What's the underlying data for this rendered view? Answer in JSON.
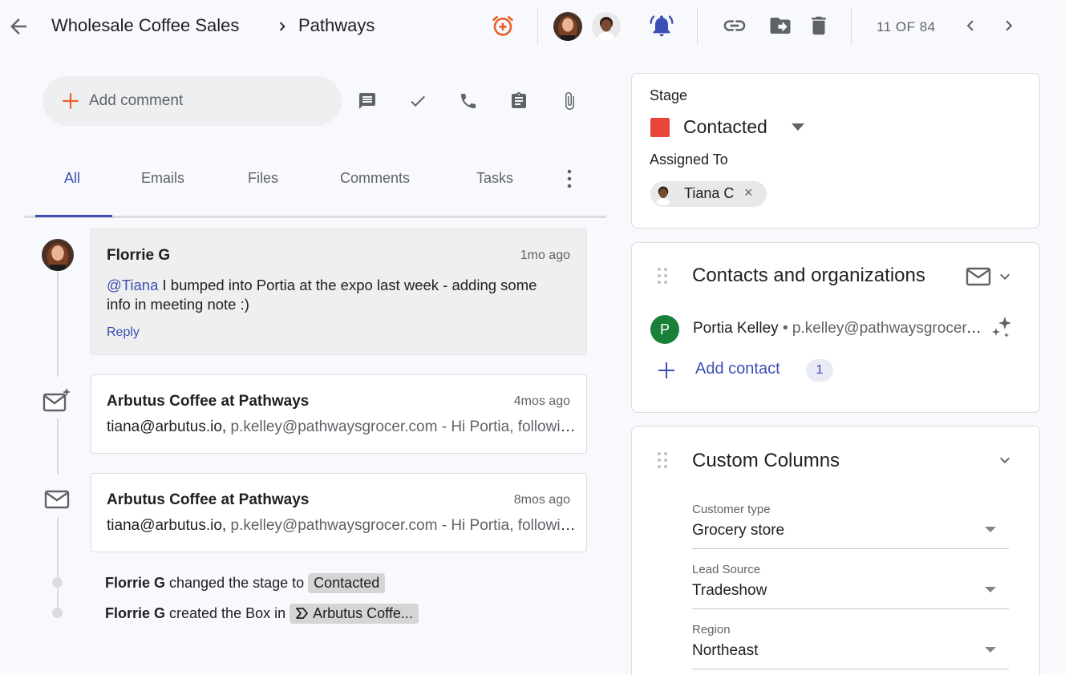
{
  "header": {
    "breadcrumb_parent": "Wholesale Coffee Sales",
    "breadcrumb_current": "Pathways",
    "counter": "11 OF 84",
    "icons": [
      "back-arrow-icon",
      "alarm-add-icon",
      "notification-bell-icon",
      "link-icon",
      "move-folder-icon",
      "trash-icon",
      "chevron-left-icon",
      "chevron-right-icon"
    ],
    "accent_alarm": "#e8612c",
    "accent_bell": "#3c4fb5"
  },
  "composer": {
    "placeholder": "Add comment"
  },
  "tabs": [
    "All",
    "Emails",
    "Files",
    "Comments",
    "Tasks"
  ],
  "timeline": {
    "comment": {
      "author": "Florrie G",
      "time": "1mo ago",
      "mention": "@Tiana",
      "text": " I bumped into Portia at the expo last week - adding some info in meeting note :)",
      "reply_label": "Reply"
    },
    "email1": {
      "subject": "Arbutus Coffee at Pathways",
      "time": "4mos ago",
      "from": "tiana@arbutus.io,",
      "rest": " p.kelley@pathwaysgrocer.com - Hi Portia, following up on our call about wholesale pricing"
    },
    "email2": {
      "subject": "Arbutus Coffee at Pathways",
      "time": "8mos ago",
      "from": "tiana@arbutus.io,",
      "rest": " p.kelley@pathwaysgrocer.com - Hi Portia, following up on our call about wholesale pricing"
    },
    "activity1": {
      "actor": "Florrie G",
      "text": " changed the stage to ",
      "chip": "Contacted"
    },
    "activity2": {
      "actor": "Florrie G",
      "text": " created the Box in ",
      "chip": "Arbutus Coffe..."
    }
  },
  "stage_panel": {
    "stage_label": "Stage",
    "stage_value": "Contacted",
    "stage_color": "#e8453c",
    "assigned_label": "Assigned To",
    "assignee": "Tiana C",
    "remove_glyph": "×"
  },
  "contacts_panel": {
    "title": "Contacts and organizations",
    "contact_initial": "P",
    "contact_name": "Portia Kelley",
    "contact_sep": " • ",
    "contact_email": "p.kelley@pathwaysgrocer.com",
    "add_label": "Add contact",
    "count": "1"
  },
  "custom_panel": {
    "title": "Custom Columns",
    "fields": [
      {
        "label": "Customer type",
        "value": "Grocery store"
      },
      {
        "label": "Lead Source",
        "value": "Tradeshow"
      },
      {
        "label": "Region",
        "value": "Northeast"
      }
    ]
  }
}
